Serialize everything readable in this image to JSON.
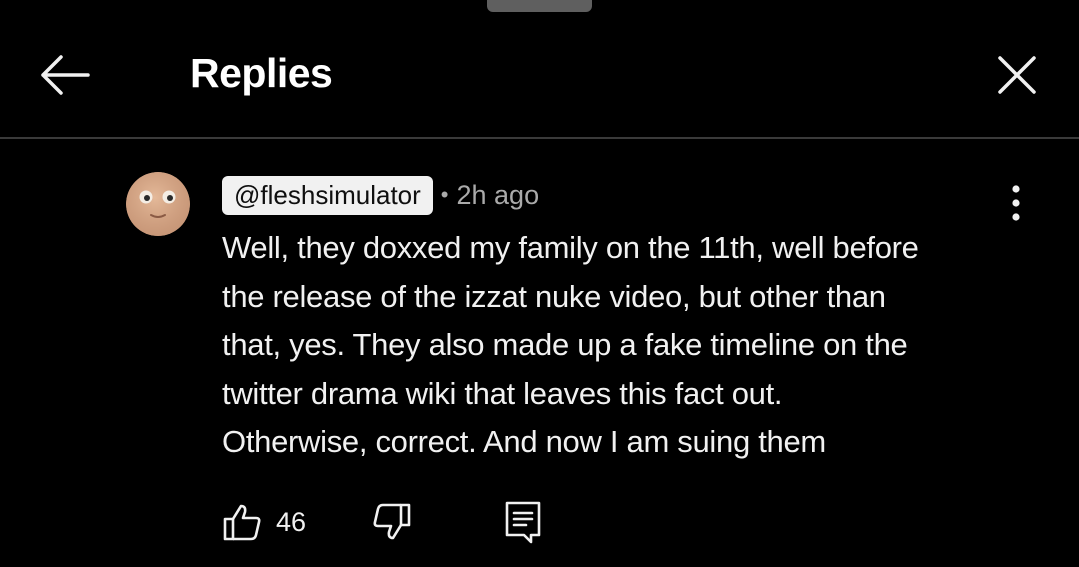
{
  "header": {
    "title": "Replies",
    "back_icon": "arrow-left-icon",
    "close_icon": "close-icon"
  },
  "comment": {
    "handle": "@fleshsimulator",
    "separator": "•",
    "timestamp": "2h ago",
    "lines": [
      "Well, they doxxed my family on the 11th, well before",
      "the release of the izzat nuke video, but other than",
      "that, yes. They also made up a fake timeline on the",
      "twitter drama wiki that leaves this fact out.",
      "Otherwise, correct. And now I am suing them"
    ],
    "like_count": "46",
    "icons": {
      "avatar": "avatar",
      "more": "more-vertical-icon",
      "like": "thumbs-up-icon",
      "dislike": "thumbs-down-icon",
      "reply": "reply-comment-icon"
    }
  },
  "colors": {
    "background": "#000000",
    "text": "#f1f1f1",
    "secondary_text": "#aaaaaa",
    "divider": "#3a3a3a",
    "handle_bg": "#f1f1f1"
  }
}
